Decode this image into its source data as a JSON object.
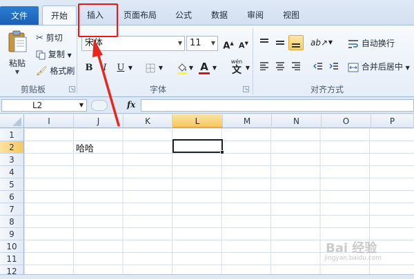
{
  "ribbon_tabs": [
    {
      "label": "文件"
    },
    {
      "label": "开始"
    },
    {
      "label": "插入"
    },
    {
      "label": "页面布局"
    },
    {
      "label": "公式"
    },
    {
      "label": "数据"
    },
    {
      "label": "审阅"
    },
    {
      "label": "视图"
    }
  ],
  "active_tab": "开始",
  "highlighted_tab": "插入",
  "clipboard": {
    "paste_label": "粘贴",
    "cut_label": "剪切",
    "copy_label": "复制",
    "format_painter_label": "格式刷",
    "group_label": "剪贴板"
  },
  "font": {
    "font_name": "宋体",
    "font_size": "11",
    "bold_label": "B",
    "italic_label": "I",
    "underline_label": "U",
    "grow_label": "A",
    "shrink_label": "A",
    "text_color_label": "A",
    "phonetic_label": "wén",
    "phonetic_char": "文",
    "group_label": "字体"
  },
  "alignment": {
    "wrap_text_label": "自动换行",
    "merge_center_label": "合并后居中",
    "group_label": "对齐方式"
  },
  "formula_bar": {
    "name_box": "L2",
    "fx_label": "fx",
    "content": ""
  },
  "columns": [
    "I",
    "J",
    "K",
    "L",
    "M",
    "N",
    "O",
    "P"
  ],
  "selected_column": "L",
  "rows": [
    "1",
    "2",
    "3",
    "4",
    "5",
    "6",
    "7",
    "8",
    "9",
    "10",
    "11",
    "12"
  ],
  "selected_row": "2",
  "cells": [
    {
      "ref": "J2",
      "value": "哈哈"
    }
  ],
  "watermark": {
    "text": "Bai 经验",
    "sub": "jingyan.baidu.com"
  },
  "colors": {
    "file_tab": "#1a5fb3",
    "highlight_box": "#f01515",
    "arrow": "#e8261c",
    "selection": "#f6c860",
    "text_color_underline": "#e01010",
    "fill_color_underline": "#ffff00"
  }
}
